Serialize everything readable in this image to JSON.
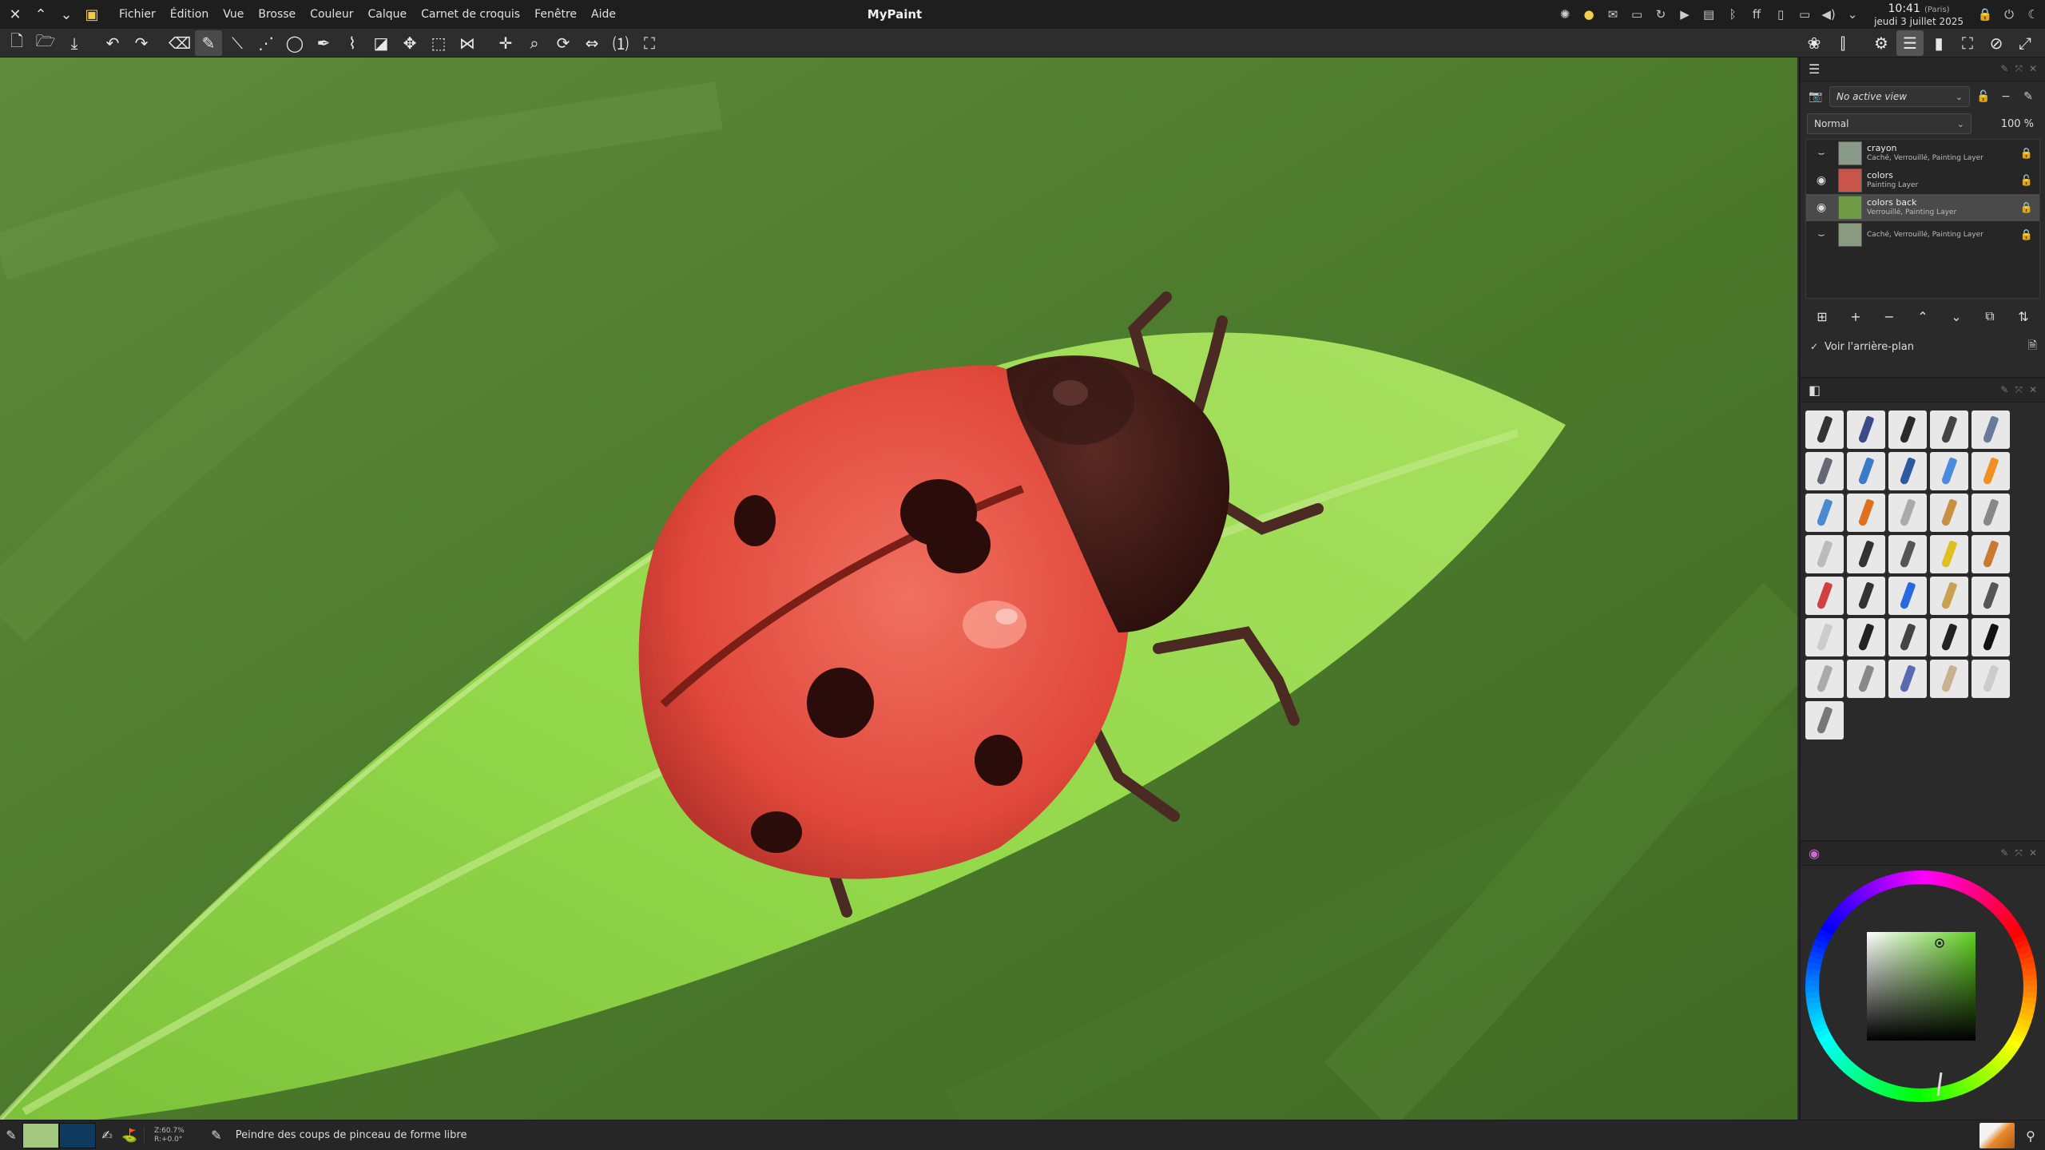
{
  "app": {
    "title": "MyPaint"
  },
  "menu": [
    "Fichier",
    "Édition",
    "Vue",
    "Brosse",
    "Couleur",
    "Calque",
    "Carnet de croquis",
    "Fenêtre",
    "Aide"
  ],
  "clock": {
    "time": "10:41",
    "tz": "(Paris)",
    "date": "jeudi 3 juillet 2025"
  },
  "layers": {
    "view_select": "No active view",
    "mode": "Normal",
    "opacity": "100 %",
    "items": [
      {
        "name": "crayon",
        "desc": "Caché, Verrouillé, Painting Layer",
        "visible": false,
        "locked": true,
        "selected": false,
        "thumb": "#8a9a88"
      },
      {
        "name": "colors",
        "desc": "Painting Layer",
        "visible": true,
        "locked": false,
        "selected": false,
        "thumb": "#c8554a"
      },
      {
        "name": "colors back",
        "desc": "Verrouillé, Painting Layer",
        "visible": true,
        "locked": true,
        "selected": true,
        "thumb": "#6f9a46"
      },
      {
        "name": "",
        "desc": "Caché, Verrouillé, Painting Layer",
        "visible": false,
        "locked": true,
        "selected": false,
        "thumb": "#889b80"
      }
    ],
    "show_background_label": "Voir l'arrière-plan"
  },
  "brushes": {
    "count": 36,
    "colors": [
      "#333",
      "#3a4a8a",
      "#2a2a2a",
      "#444",
      "#6a7a9a",
      "#667",
      "#3a7ac8",
      "#2a5aa0",
      "#4a8ae0",
      "#f09020",
      "#4a8ad0",
      "#e07020",
      "#aaa",
      "#c89040",
      "#888",
      "#bbb",
      "#333",
      "#555",
      "#e0c020",
      "#c87a30",
      "#d04040",
      "#333",
      "#2a6ae0",
      "#c8a050",
      "#555",
      "#ccc",
      "#222",
      "#444",
      "#222",
      "#111",
      "#aaa",
      "#888",
      "#5a6ab0",
      "#c8b090",
      "#ccc",
      "#777"
    ]
  },
  "colors": {
    "primary": "#a3c77e",
    "secondary": "#0d3a5e",
    "accent": "#5a9a2a"
  },
  "status": {
    "zoom": "Z:60.7%",
    "rotation": "R:+0.0°",
    "message": "Peindre des coups de pinceau de forme libre"
  }
}
